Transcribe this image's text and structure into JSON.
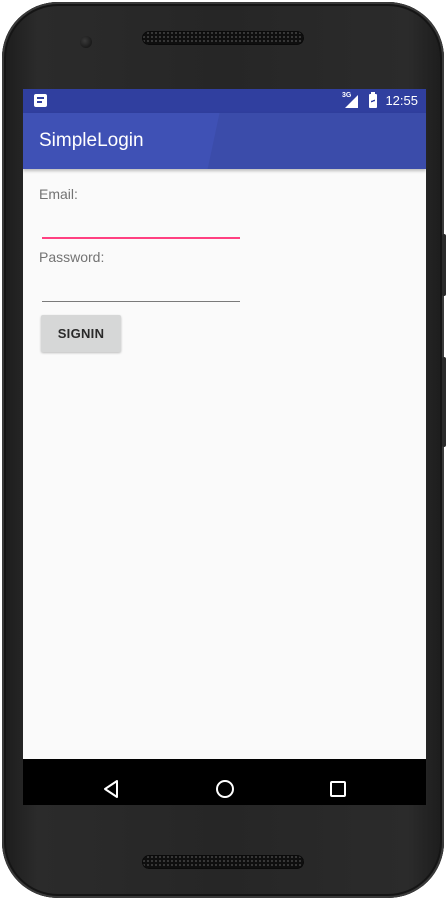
{
  "status_bar": {
    "network_type": "3G",
    "time": "12:55",
    "icons": [
      "notification-icon",
      "signal-icon",
      "battery-icon"
    ]
  },
  "app_bar": {
    "title": "SimpleLogin"
  },
  "form": {
    "email_label": "Email:",
    "email_value": "",
    "password_label": "Password:",
    "password_value": "",
    "signin_label": "SIGNIN"
  },
  "nav_bar": {
    "icons": [
      "back-icon",
      "home-icon",
      "recents-icon"
    ]
  },
  "colors": {
    "primary": "#3f51b5",
    "primary_dark": "#303f9f",
    "accent": "#ff4081",
    "background": "#fafafa"
  }
}
